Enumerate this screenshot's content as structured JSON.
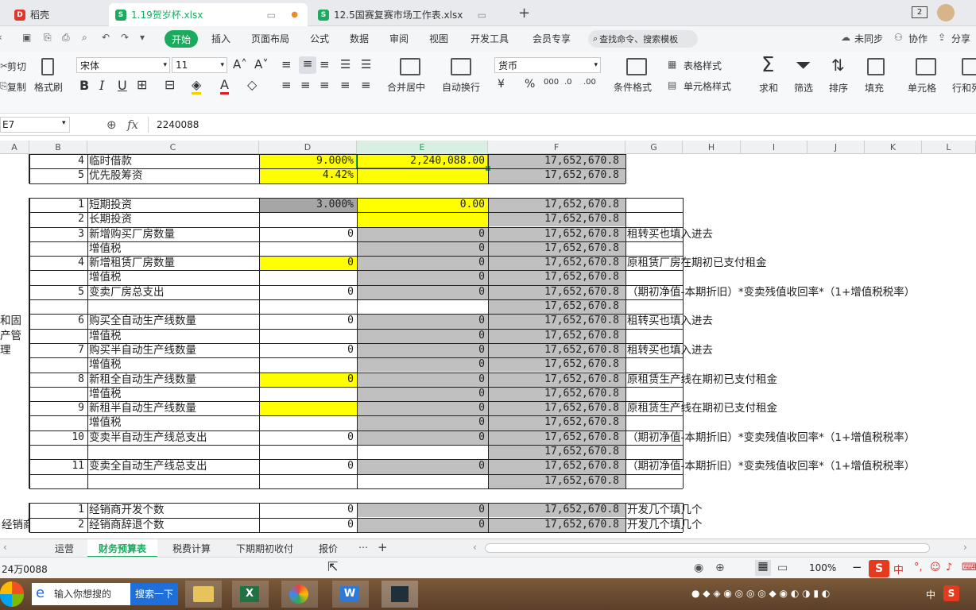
{
  "tabs": [
    {
      "label": "稻壳",
      "active": false
    },
    {
      "label": "1.19贺岁杯.xlsx",
      "active": true
    },
    {
      "label": "12.5国赛复赛市场工作表.xlsx",
      "active": false
    }
  ],
  "tab_count": "2",
  "menu": {
    "start": "开始",
    "items": [
      "插入",
      "页面布局",
      "公式",
      "数据",
      "审阅",
      "视图",
      "开发工具",
      "会员专享"
    ],
    "search": "查找命令、搜索模板",
    "right": [
      "未同步",
      "协作",
      "分享"
    ]
  },
  "ribbon": {
    "cut": "剪切",
    "copy": "复制",
    "format_painter": "格式刷",
    "font_name": "宋体",
    "font_size": "11",
    "merge": "合并居中",
    "wrap": "自动换行",
    "number_format": "货币",
    "cond_format": "条件格式",
    "table_style": "表格样式",
    "cell_style": "单元格样式",
    "sum": "求和",
    "filter": "筛选",
    "sort": "排序",
    "fill": "填充",
    "cells": "单元格",
    "rowcol": "行和列"
  },
  "formula": {
    "name_box": "E7",
    "fx": "fx",
    "value": "2240088"
  },
  "columns": [
    "A",
    "B",
    "C",
    "D",
    "E",
    "F",
    "G",
    "H",
    "I",
    "J",
    "K",
    "L"
  ],
  "rows": [
    {
      "b": "4",
      "c": "临时借款",
      "d": "9.000%",
      "e": "2,240,088.00",
      "f": "17,652,670.8",
      "g": ""
    },
    {
      "b": "5",
      "c": "优先股筹资",
      "d": "4.42%",
      "e": "",
      "f": "17,652,670.8",
      "g": ""
    },
    {
      "b": "",
      "c": "",
      "d": "",
      "e": "",
      "f": "",
      "g": ""
    },
    {
      "b": "1",
      "c": "短期投资",
      "d": "3.000%",
      "e": "0.00",
      "f": "17,652,670.8",
      "g": ""
    },
    {
      "b": "2",
      "c": "长期投资",
      "d": "",
      "e": "",
      "f": "17,652,670.8",
      "g": ""
    },
    {
      "b": "3",
      "c": "新增购买厂房数量",
      "d": "0",
      "e": "0",
      "f": "17,652,670.8",
      "g": "租转买也填入进去"
    },
    {
      "b": "",
      "c": "增值税",
      "d": "",
      "e": "0",
      "f": "17,652,670.8",
      "g": ""
    },
    {
      "b": "4",
      "c": "新增租赁厂房数量",
      "d": "0",
      "e": "0",
      "f": "17,652,670.8",
      "g": "原租赁厂房在期初已支付租金"
    },
    {
      "b": "",
      "c": "增值税",
      "d": "",
      "e": "0",
      "f": "17,652,670.8",
      "g": ""
    },
    {
      "b": "5",
      "c": "变卖厂房总支出",
      "d": "0",
      "e": "0",
      "f": "17,652,670.8",
      "g": "（期初净值-本期折旧）*变卖残值收回率*（1+增值税税率）"
    },
    {
      "b": "",
      "c": "",
      "d": "",
      "e": "",
      "f": "17,652,670.8",
      "g": ""
    },
    {
      "b": "6",
      "c": "购买全自动生产线数量",
      "d": "0",
      "e": "0",
      "f": "17,652,670.8",
      "g": "租转买也填入进去"
    },
    {
      "b": "",
      "c": "增值税",
      "d": "",
      "e": "0",
      "f": "17,652,670.8",
      "g": ""
    },
    {
      "b": "7",
      "c": "购买半自动生产线数量",
      "d": "0",
      "e": "0",
      "f": "17,652,670.8",
      "g": "租转买也填入进去"
    },
    {
      "b": "",
      "c": "增值税",
      "d": "",
      "e": "0",
      "f": "17,652,670.8",
      "g": ""
    },
    {
      "b": "8",
      "c": "新租全自动生产线数量",
      "d": "0",
      "e": "0",
      "f": "17,652,670.8",
      "g": "原租赁生产线在期初已支付租金"
    },
    {
      "b": "",
      "c": "增值税",
      "d": "",
      "e": "0",
      "f": "17,652,670.8",
      "g": ""
    },
    {
      "b": "9",
      "c": "新租半自动生产线数量",
      "d": "",
      "e": "0",
      "f": "17,652,670.8",
      "g": "原租赁生产线在期初已支付租金"
    },
    {
      "b": "",
      "c": "增值税",
      "d": "",
      "e": "0",
      "f": "17,652,670.8",
      "g": ""
    },
    {
      "b": "10",
      "c": "变卖半自动生产线总支出",
      "d": "0",
      "e": "0",
      "f": "17,652,670.8",
      "g": "（期初净值-本期折旧）*变卖残值收回率*（1+增值税税率）"
    },
    {
      "b": "",
      "c": "",
      "d": "",
      "e": "",
      "f": "17,652,670.8",
      "g": ""
    },
    {
      "b": "11",
      "c": "变卖全自动生产线总支出",
      "d": "0",
      "e": "0",
      "f": "17,652,670.8",
      "g": "（期初净值-本期折旧）*变卖残值收回率*（1+增值税税率）"
    },
    {
      "b": "",
      "c": "",
      "d": "",
      "e": "",
      "f": "17,652,670.8",
      "g": ""
    },
    {
      "b": "",
      "c": "",
      "d": "",
      "e": "",
      "f": "",
      "g": ""
    },
    {
      "b": "1",
      "c": "经销商开发个数",
      "d": "0",
      "e": "0",
      "f": "17,652,670.8",
      "g": "开发几个填几个"
    },
    {
      "b": "2",
      "c": "经销商辞退个数",
      "d": "0",
      "e": "0",
      "f": "17,652,670.8",
      "g": "开发几个填几个"
    }
  ],
  "group_label_a": [
    "和固",
    "产管",
    "理"
  ],
  "group_label_b": "经销商",
  "sheets": [
    "运营",
    "财务预算表",
    "税费计算",
    "下期期初收付",
    "报价"
  ],
  "active_sheet": "财务预算表",
  "status": {
    "left": "24万0088",
    "zoom": "100%"
  },
  "taskbar": {
    "search_placeholder": "输入你想搜的",
    "search_button": "搜索一下",
    "ime": "中"
  },
  "colors": {
    "yellow": "#ffff00",
    "gray": "#c0c0c0",
    "accent": "#1aab5e"
  }
}
